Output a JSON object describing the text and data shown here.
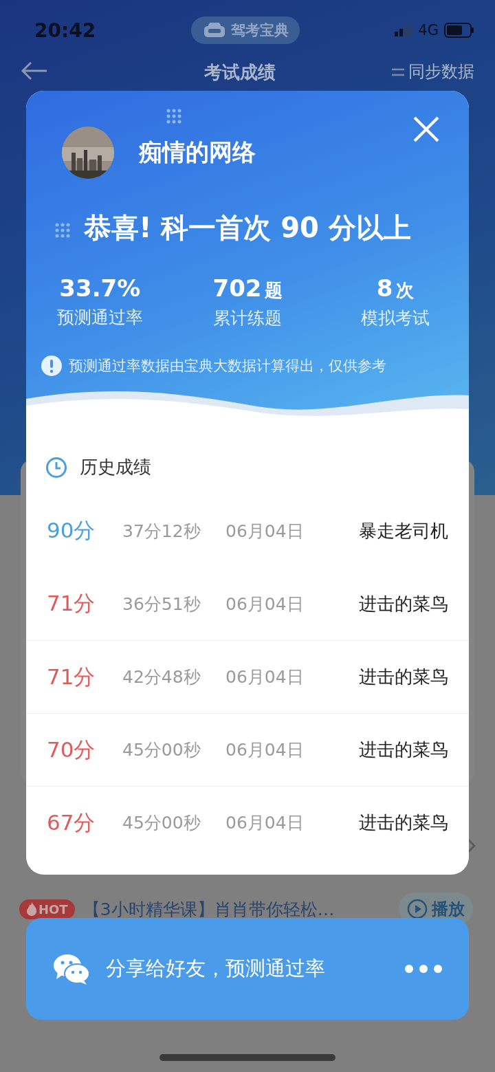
{
  "status_bar": {
    "time": "20:42",
    "network": "4G"
  },
  "app_badge": {
    "label": "驾考宝典"
  },
  "nav": {
    "title": "考试成绩",
    "action": "同步数据"
  },
  "course_row": {
    "badge": "HOT",
    "text": "【3小时精华课】肖肖带你轻松…",
    "play_button": "播放"
  },
  "modal": {
    "user_name": "痴情的网络",
    "headline": "恭喜! 科一首次 90 分以上",
    "stats": [
      {
        "value": "33.7%",
        "label": "预测通过率"
      },
      {
        "value": "702",
        "unit": "题",
        "label": "累计练题"
      },
      {
        "value": "8",
        "unit": "次",
        "label": "模拟考试"
      }
    ],
    "note": "预测通过率数据由宝典大数据计算得出，仅供参考",
    "history": {
      "title": "历史成绩",
      "rows": [
        {
          "score": "90分",
          "color": "#4a9fe0",
          "duration": "37分12秒",
          "date": "06月04日",
          "rank": "暴走老司机"
        },
        {
          "score": "71分",
          "color": "#e05a5a",
          "duration": "36分51秒",
          "date": "06月04日",
          "rank": "进击的菜鸟"
        },
        {
          "score": "71分",
          "color": "#e05a5a",
          "duration": "42分48秒",
          "date": "06月04日",
          "rank": "进击的菜鸟"
        },
        {
          "score": "70分",
          "color": "#e05a5a",
          "duration": "45分00秒",
          "date": "06月04日",
          "rank": "进击的菜鸟"
        },
        {
          "score": "67分",
          "color": "#e05a5a",
          "duration": "45分00秒",
          "date": "06月04日",
          "rank": "进击的菜鸟"
        }
      ]
    }
  },
  "share_bar": {
    "label": "分享给好友，预测通过率"
  }
}
